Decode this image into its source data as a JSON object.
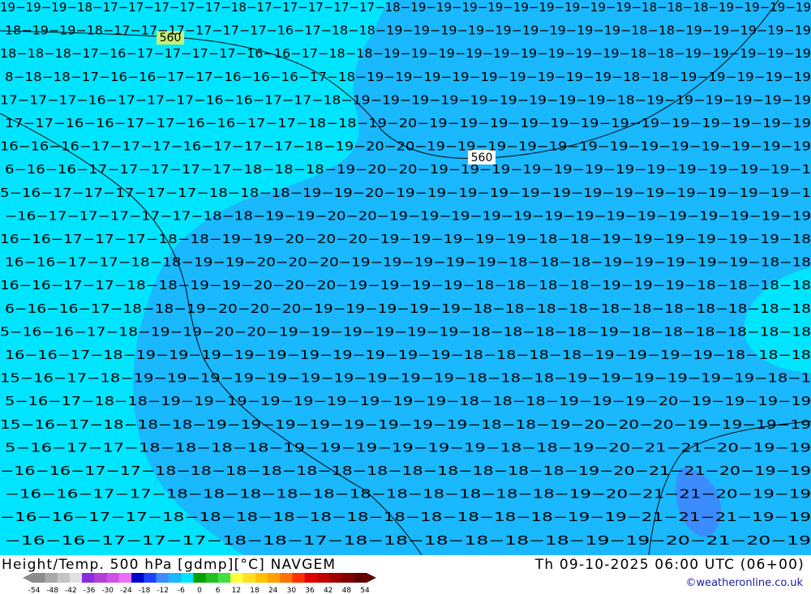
{
  "map": {
    "field": "Height/Temp. 500 hPa",
    "units": "[gdmp][°C]",
    "model": "NAVGEM",
    "colors": {
      "outer_cyan": "#00e5ff",
      "mid_blue": "#1ab8ff",
      "core_blue": "#3a8cff",
      "contour": "#000000"
    },
    "contour_labels": [
      "560",
      "560"
    ],
    "temperature_rows": [
      "19−19−19−18−17−17−17−17−17−18−17−17−17−17−17−18−19−19−19−19−19−19−19−19−19−18−18−18−19−19−19−19",
      "18−19−19−18−17−17−17−17−17−17−16−17−18−18−19−19−19−19−19−19−19−19−19−18−18−19−19−19−19−19",
      "18−18−18−17−16−17−17−17−17−16−16−17−18−18−19−19−19−19−19−19−19−19−19−18−18−19−19−19−19−19",
      "8−18−18−17−16−16−17−17−16−16−16−17−18−19−19−19−19−19−19−19−19−19−18−18−19−19−19−19−19",
      "17−17−17−16−17−17−17−16−16−17−17−18−19−19−19−19−19−19−19−19−19−18−19−19−19−19−19−19",
      "17−17−16−16−17−17−16−16−17−17−18−18−19−20−19−19−19−19−19−19−19−19−19−19−19−19−19",
      "16−16−16−17−17−17−16−17−17−17−18−19−20−20−19−19−19−19−19−19−19−19−19−19−19−19−19",
      "6−16−16−17−17−17−17−17−18−18−18−19−20−20−19−19−19−19−19−19−19−19−19−19−19−19−1",
      "5−16−17−17−17−17−17−18−18−18−19−19−20−19−19−19−19−19−19−19−19−19−19−19−19−19−1",
      "−16−17−17−17−17−17−18−18−19−19−20−20−19−19−19−19−19−19−19−19−19−19−19−19−19−19",
      "16−16−17−17−17−18−18−19−19−20−20−20−19−19−19−19−19−18−18−19−19−19−19−19−19−18",
      "16−16−17−17−18−18−19−19−20−20−20−19−19−19−19−19−18−18−18−19−19−19−19−19−18−18",
      "16−16−17−17−18−18−19−19−20−20−20−19−19−19−19−18−18−18−18−19−19−19−18−18−18−18",
      "6−16−16−17−18−18−19−20−20−20−19−19−19−19−19−18−18−18−18−18−18−18−18−18−18−18",
      "5−16−16−17−18−19−19−20−20−19−19−19−19−19−19−18−18−18−18−19−18−18−18−18−18−18",
      "16−16−17−18−19−19−19−19−19−19−19−19−19−19−18−18−18−18−19−19−19−19−18−18−18",
      "15−16−17−18−19−19−19−19−19−19−19−19−19−19−18−18−18−19−19−19−19−19−19−18−1",
      "5−16−17−18−18−19−19−19−19−19−19−19−19−19−18−18−18−19−19−19−20−19−19−19−19",
      "15−16−17−18−18−18−19−19−19−19−19−19−19−19−18−18−19−20−20−20−19−19−19−19",
      "5−16−17−17−18−18−18−18−19−19−19−19−19−19−18−18−19−20−21−21−20−19−19",
      "−16−16−17−17−18−18−18−18−18−18−18−18−18−18−18−18−19−20−21−21−20−19−19",
      "−16−16−17−17−18−18−18−18−18−18−18−18−18−18−18−19−20−21−21−20−19−19",
      "−16−16−17−17−18−18−18−18−18−18−18−18−18−18−18−19−19−21−21−21−19−19",
      "−16−16−17−17−17−18−18−17−18−18−18−18−18−18−19−19−20−21−20−19"
    ]
  },
  "footer": {
    "title": "Height/Temp. 500 hPa [gdmp][°C] NAVGEM",
    "datetime": "Th 09-10-2025 06:00 UTC (06+00)",
    "credit": "©weatheronline.co.uk",
    "legend_ticks": [
      "-54",
      "-48",
      "-42",
      "-36",
      "-30",
      "-24",
      "-18",
      "-12",
      "-6",
      "0",
      "6",
      "12",
      "18",
      "24",
      "30",
      "36",
      "42",
      "48",
      "54"
    ],
    "legend_colors": [
      "#8c8c8c",
      "#a8a8a8",
      "#c4c4c4",
      "#e0e0e0",
      "#8a2be2",
      "#b040d8",
      "#d050e8",
      "#e870f8",
      "#0000c8",
      "#2040ff",
      "#3a8cff",
      "#1ab8ff",
      "#00e5ff",
      "#00a000",
      "#20c020",
      "#40e040",
      "#ffff40",
      "#ffe020",
      "#ffc000",
      "#ffa000",
      "#ff7000",
      "#ff3000",
      "#e00000",
      "#c00000",
      "#a00000",
      "#800000",
      "#600000"
    ]
  }
}
